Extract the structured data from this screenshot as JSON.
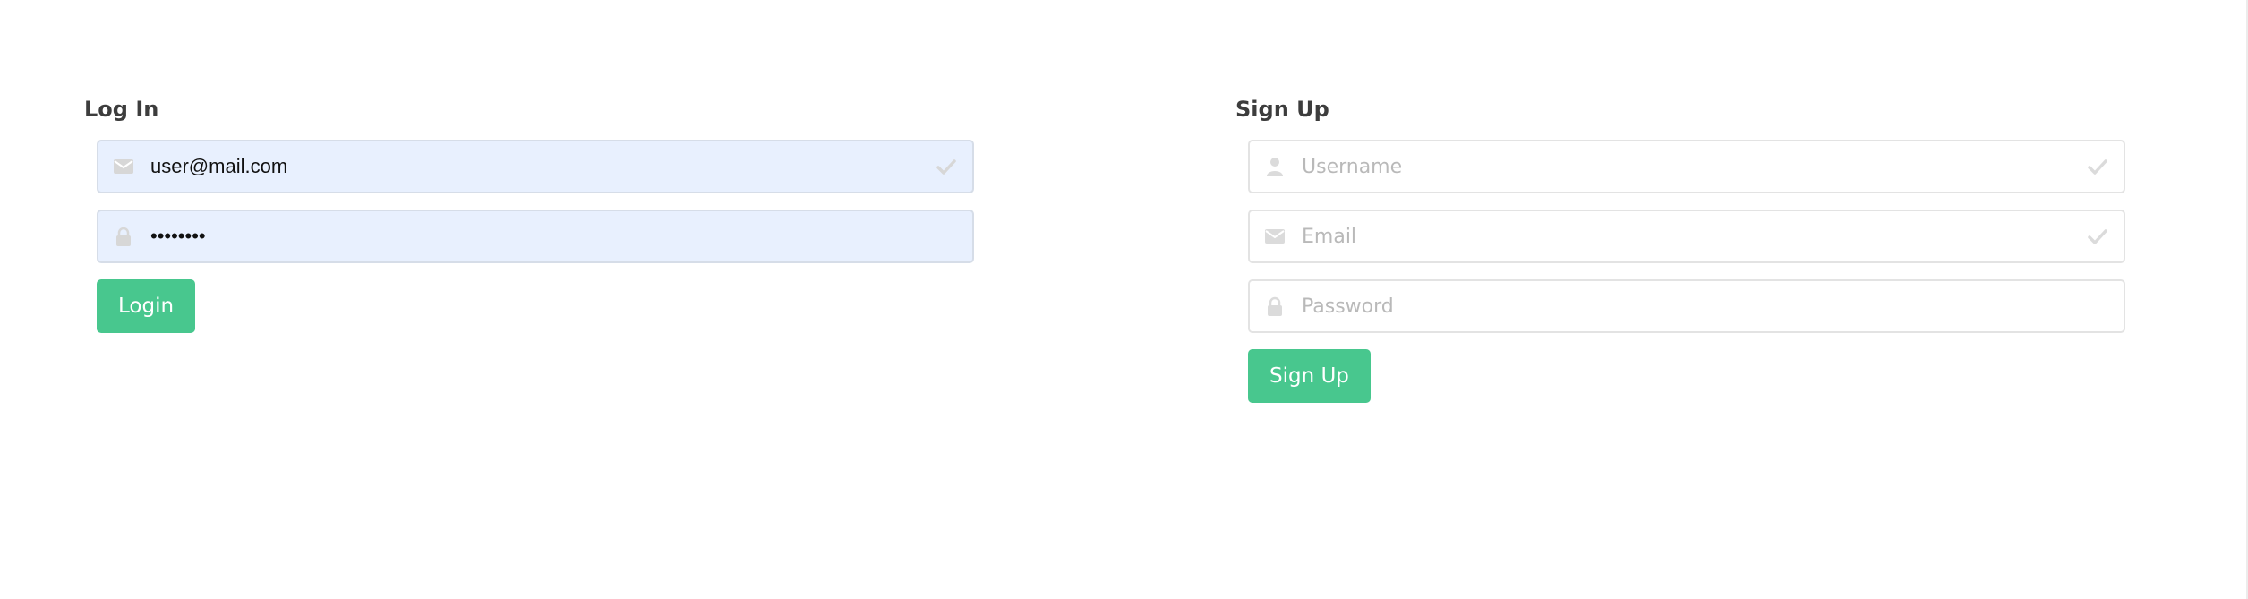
{
  "login": {
    "title": "Log In",
    "email": {
      "value": "user@mail.com",
      "icon": "envelope-icon",
      "status_icon": "check-icon"
    },
    "password": {
      "value": "••••••••",
      "icon": "lock-icon"
    },
    "submit_label": "Login"
  },
  "signup": {
    "title": "Sign Up",
    "username": {
      "placeholder": "Username",
      "icon": "user-icon",
      "status_icon": "check-icon"
    },
    "email": {
      "placeholder": "Email",
      "icon": "envelope-icon",
      "status_icon": "check-icon"
    },
    "password": {
      "placeholder": "Password",
      "icon": "lock-icon"
    },
    "submit_label": "Sign Up"
  },
  "colors": {
    "primary": "#48c78e",
    "autofill_bg": "#e8f0fe",
    "icon": "#dbdbdb",
    "heading": "#3d3d3d"
  }
}
